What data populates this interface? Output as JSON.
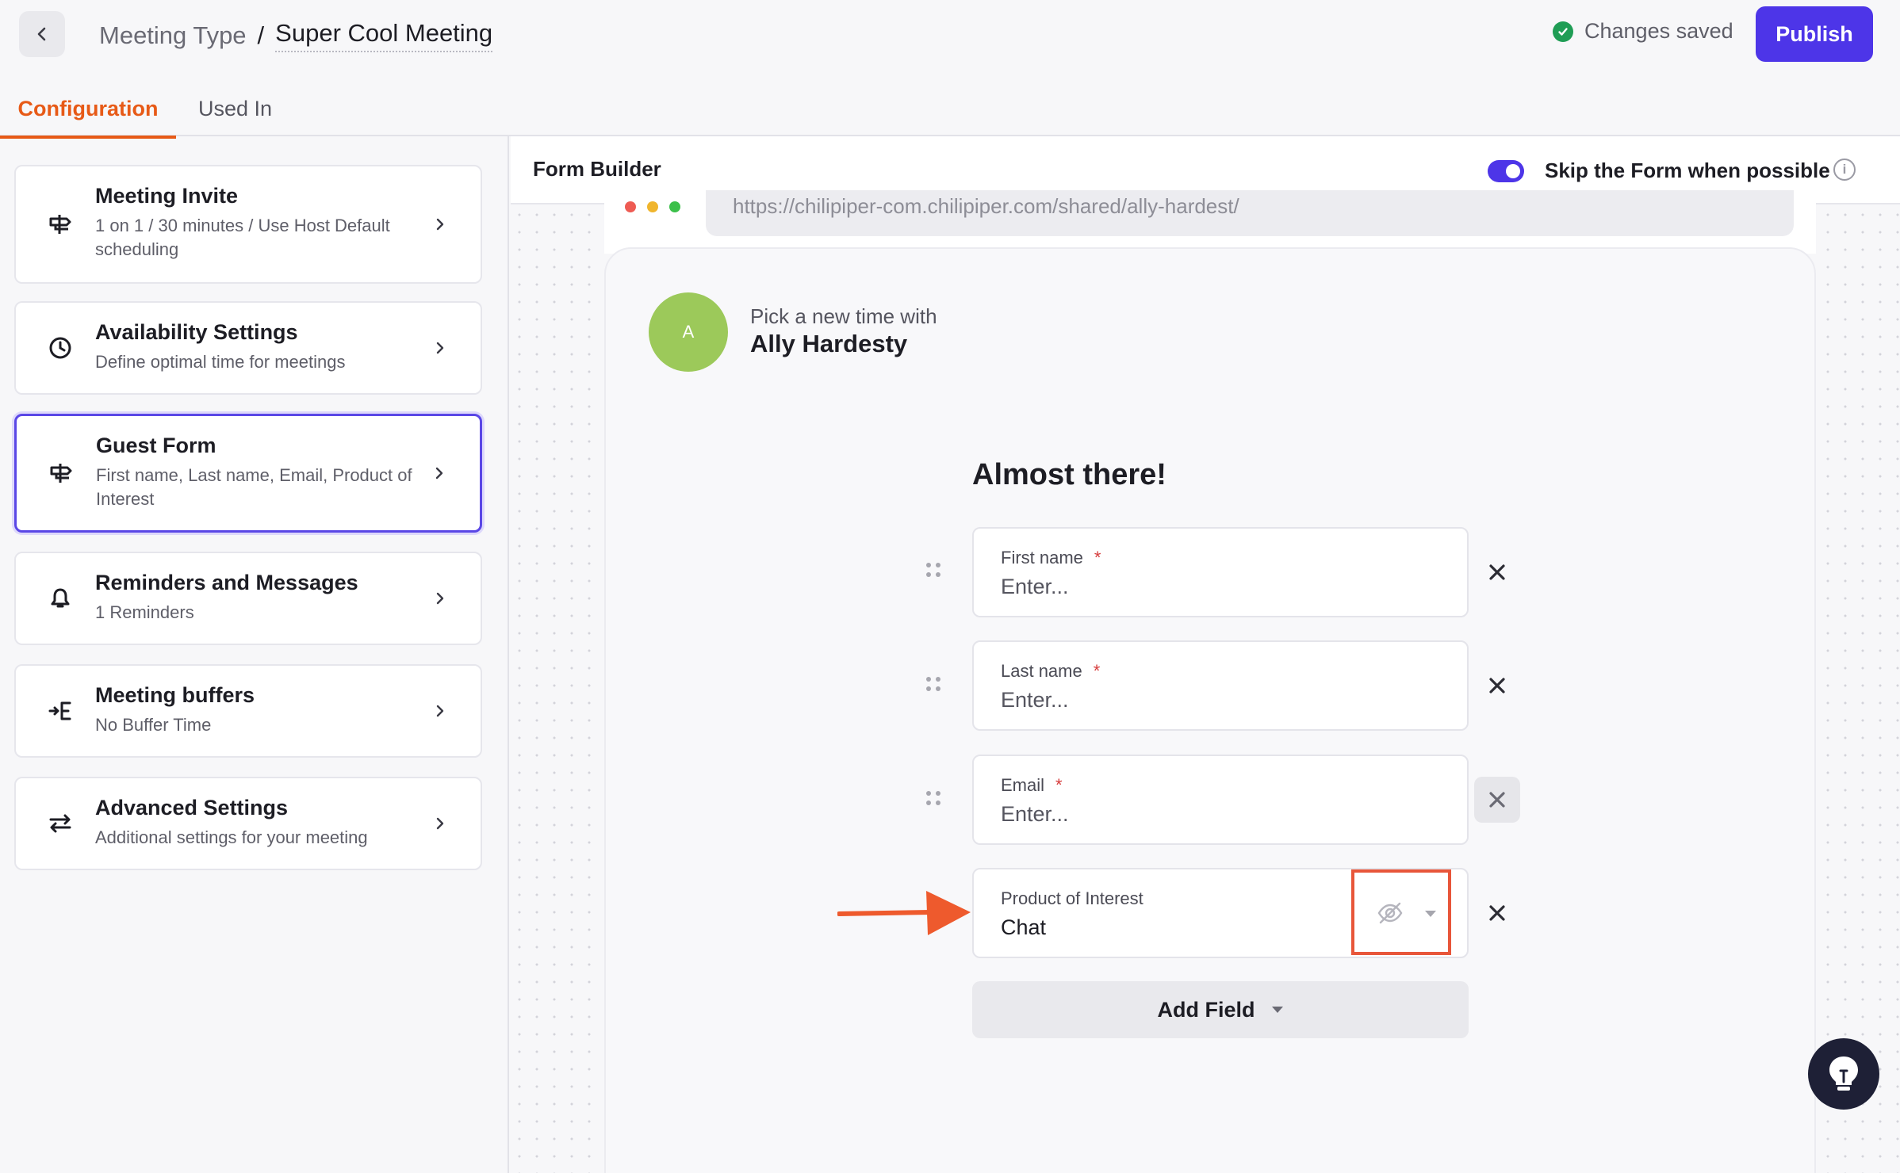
{
  "header": {
    "breadcrumb_parent": "Meeting Type",
    "breadcrumb_sep": "/",
    "breadcrumb_current": "Super Cool Meeting",
    "status_text": "Changes saved",
    "publish_label": "Publish"
  },
  "tabs": [
    {
      "label": "Configuration"
    },
    {
      "label": "Used In"
    }
  ],
  "sidebar": {
    "items": [
      {
        "title": "Meeting Invite",
        "desc": "1 on 1 / 30 minutes / Use Host Default scheduling"
      },
      {
        "title": "Availability Settings",
        "desc": "Define optimal time for meetings"
      },
      {
        "title": "Guest Form",
        "desc": "First name, Last name, Email, Product of Interest"
      },
      {
        "title": "Reminders and Messages",
        "desc": "1 Reminders"
      },
      {
        "title": "Meeting buffers",
        "desc": "No Buffer Time"
      },
      {
        "title": "Advanced Settings",
        "desc": "Additional settings for your meeting"
      }
    ]
  },
  "builder": {
    "title": "Form Builder",
    "skip_label": "Skip the Form when possible",
    "url": "https://chilipiper-com.chilipiper.com/shared/ally-hardest/",
    "pick_text": "Pick a new time with",
    "host_name": "Ally Hardesty",
    "avatar_initial": "A",
    "form_heading": "Almost there!",
    "fields": [
      {
        "label": "First name",
        "required": "*",
        "value": "Enter..."
      },
      {
        "label": "Last name",
        "required": "*",
        "value": "Enter..."
      },
      {
        "label": "Email",
        "required": "*",
        "value": "Enter..."
      },
      {
        "label": "Product of Interest",
        "value": "Chat"
      }
    ],
    "add_field_label": "Add Field"
  },
  "colors": {
    "accent": "#4d35e8",
    "tab_active": "#e75a17",
    "annotation": "#e8563a",
    "success": "#1f9d55"
  }
}
